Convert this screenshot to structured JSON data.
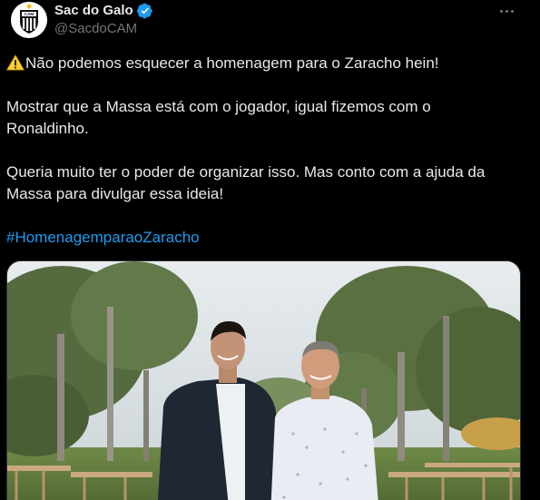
{
  "author": {
    "display_name": "Sac do Galo",
    "handle": "@SacdoCAM",
    "avatar_icon": "club-crest-icon",
    "verified_icon": "verified-badge-icon",
    "verified_color": "#1d9bf0"
  },
  "more_icon": "more-options-icon",
  "tweet": {
    "line1_icon": "warning-icon",
    "line1": "Não podemos esquecer a homenagem para o Zaracho hein!",
    "line2a": "Mostrar que a Massa está com o jogador, igual fizemos com o",
    "line2b": "Ronaldinho.",
    "line3a": "Queria muito ter o poder de organizar isso. Mas conto com a ajuda da",
    "line3b": "Massa para divulgar essa ideia!",
    "hashtag": "#HomenagemparaoZaracho"
  },
  "colors": {
    "background": "#000000",
    "text": "#e7e9ea",
    "secondary": "#71767b",
    "link": "#1d9bf0"
  }
}
